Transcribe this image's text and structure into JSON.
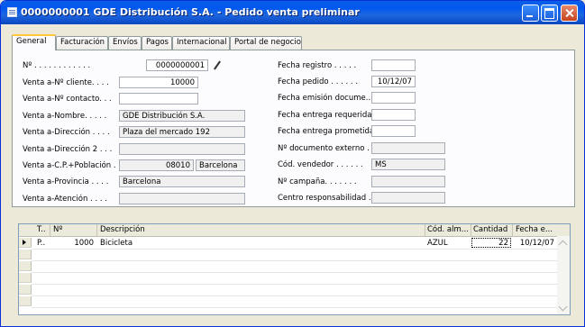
{
  "window": {
    "title": "0000000001 GDE Distribución S.A. - Pedido venta preliminar"
  },
  "tabs": [
    "General",
    "Facturación",
    "Envíos",
    "Pagos",
    "Internacional",
    "Portal de negocio"
  ],
  "left_fields": [
    {
      "label": "Nº . . . . . . . . . . . .",
      "value": "0000000001",
      "style": "right"
    },
    {
      "label": "Venta a-Nº cliente. . . .",
      "value": "10000",
      "style": "right"
    },
    {
      "label": "Venta a-Nº contacto. . .",
      "value": "",
      "style": ""
    },
    {
      "label": "Venta a-Nombre. . . . .",
      "value": "GDE Distribución S.A.",
      "style": "ro"
    },
    {
      "label": "Venta a-Dirección . . . .",
      "value": "Plaza del mercado 192",
      "style": "ro"
    },
    {
      "label": "Venta a-Dirección 2 . . .",
      "value": "",
      "style": "ro"
    },
    {
      "label": "Venta a-C.P.+Población .",
      "value": "08010",
      "value2": "Barcelona",
      "style": "ro"
    },
    {
      "label": "Venta a-Provincia . . . .",
      "value": "Barcelona",
      "style": "ro"
    },
    {
      "label": "Venta a-Atención . . . .",
      "value": "",
      "style": "ro"
    }
  ],
  "right_fields": [
    {
      "label": "Fecha registro . . . . .",
      "value": ""
    },
    {
      "label": "Fecha pedido . . . . . .",
      "value": "10/12/07"
    },
    {
      "label": "Fecha emisión docume...",
      "value": ""
    },
    {
      "label": "Fecha entrega requerida",
      "value": ""
    },
    {
      "label": "Fecha entrega prometida",
      "value": ""
    },
    {
      "label": "Nº documento externo .",
      "value": ""
    },
    {
      "label": "Cód. vendedor . . . . . .",
      "value": "MS"
    },
    {
      "label": "Nº campaña. . . . . . .",
      "value": ""
    },
    {
      "label": "Centro responsabilidad .",
      "value": ""
    }
  ],
  "lines": {
    "headers": [
      "T..",
      "Nº",
      "Descripción",
      "Cód. alm...",
      "Cantidad",
      "Fecha e..."
    ],
    "rows": [
      {
        "type": "P..",
        "no": "1000",
        "description": "Bicicleta",
        "location": "AZUL",
        "quantity": "22",
        "date": "10/12/07"
      }
    ]
  },
  "icons": {
    "lookup": "pencil-edit-icon",
    "window": "form-window-icon"
  }
}
